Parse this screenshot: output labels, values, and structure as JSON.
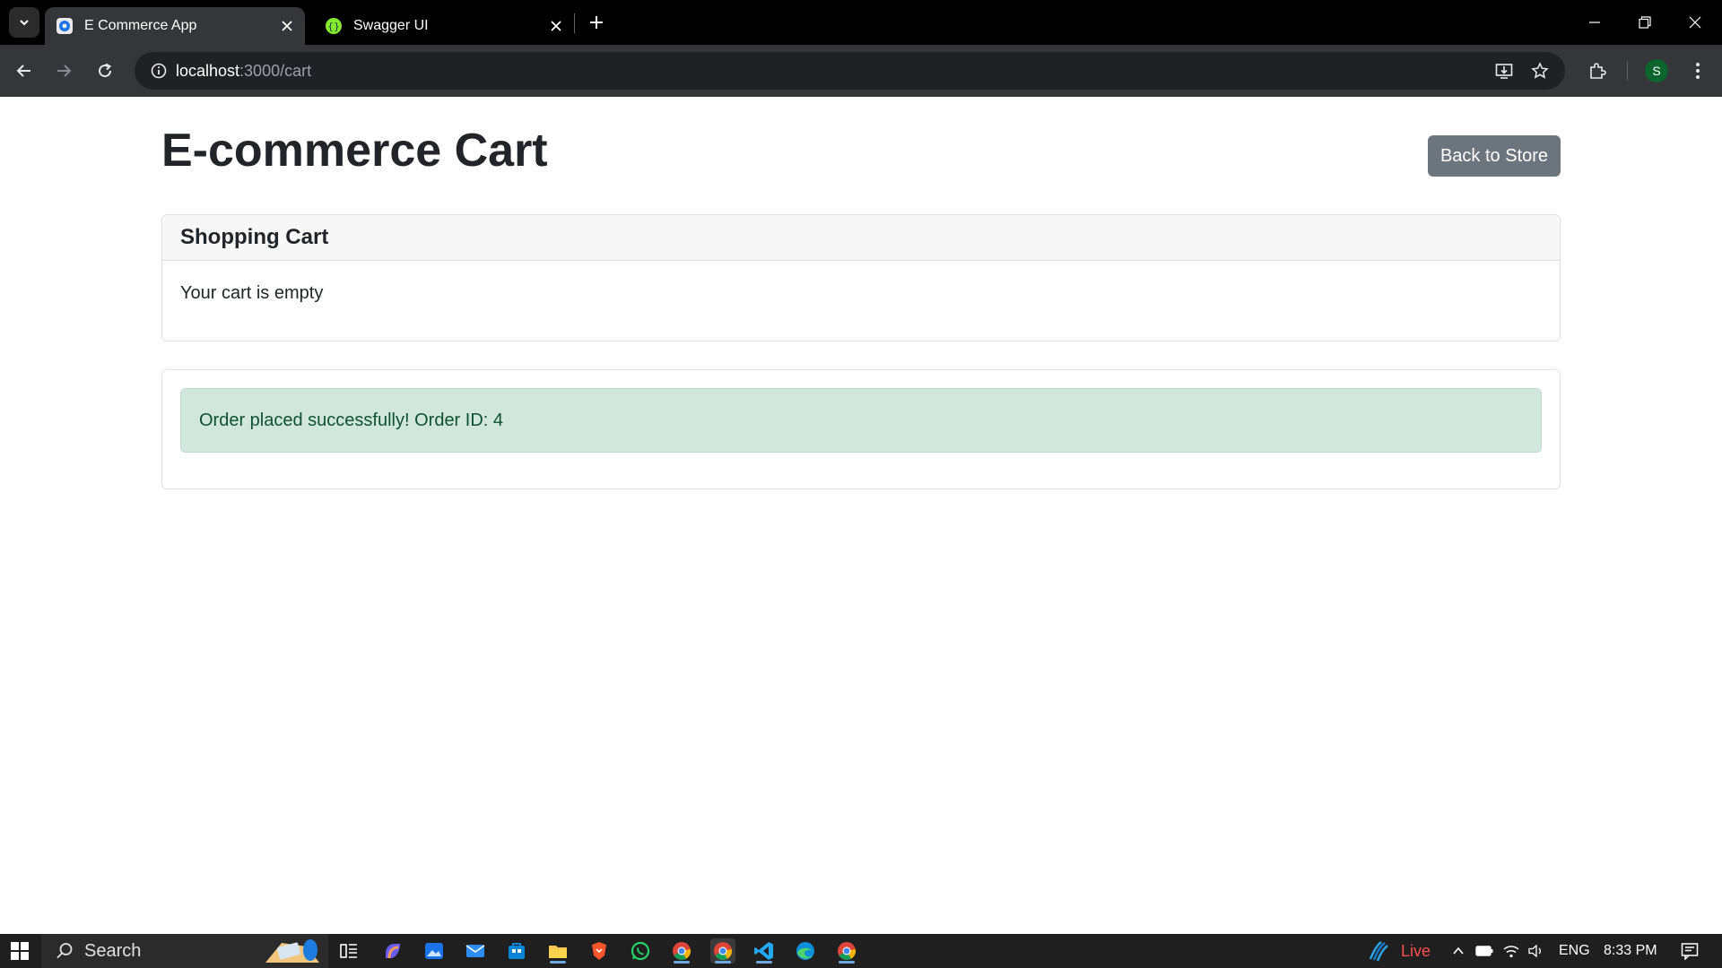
{
  "browser": {
    "tabs": [
      {
        "title": "E Commerce App",
        "active": true,
        "favicon": "ecommerce-favicon-icon"
      },
      {
        "title": "Swagger UI",
        "active": false,
        "favicon": "swagger-favicon-icon"
      }
    ],
    "url_host": "localhost",
    "url_path": ":3000/cart",
    "profile_initial": "S"
  },
  "page": {
    "title": "E-commerce Cart",
    "back_button_label": "Back to Store",
    "cart": {
      "header": "Shopping Cart",
      "empty_message": "Your cart is empty"
    },
    "order_alert": "Order placed successfully! Order ID: 4"
  },
  "taskbar": {
    "search_placeholder": "Search",
    "live_label": "Live",
    "language": "ENG",
    "time": "8:33 PM"
  },
  "colors": {
    "secondary_button": "#6c757d",
    "success_alert_bg": "#d1e7dd",
    "success_alert_text": "#0f5132",
    "browser_frame": "#35363a"
  }
}
